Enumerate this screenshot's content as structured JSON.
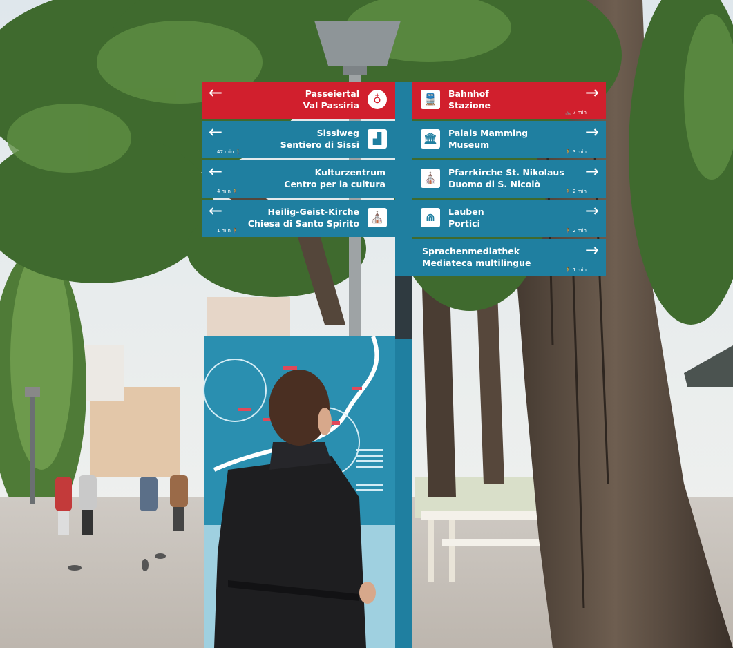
{
  "signs_left": [
    {
      "arrow": "←",
      "line1": "Passeiertal",
      "line2": "Val Passiria",
      "icon": "bicycle-icon",
      "glyph": "♁",
      "time": "",
      "color": "red"
    },
    {
      "arrow": "←",
      "line1": "Sissiweg",
      "line2": "Sentiero di Sissi",
      "icon": "monument-icon",
      "glyph": "▟",
      "time": "47 min 🚶",
      "color": "blue"
    },
    {
      "arrow": "←",
      "line1": "Kulturzentrum",
      "line2": "Centro per la cultura",
      "icon": "",
      "glyph": "",
      "time": "4 min 🚶",
      "color": "blue"
    },
    {
      "arrow": "←",
      "line1": "Heilig-Geist-Kirche",
      "line2": "Chiesa di Santo Spirito",
      "icon": "church-icon",
      "glyph": "⛪",
      "time": "1 min 🚶",
      "color": "blue"
    }
  ],
  "signs_right": [
    {
      "arrow": "→",
      "line1": "Bahnhof",
      "line2": "Stazione",
      "icon": "train-icon",
      "glyph": "🚆",
      "time": "🚲 7 min",
      "color": "red"
    },
    {
      "arrow": "→",
      "line1": "Palais Mamming",
      "line2": "Museum",
      "icon": "museum-icon",
      "glyph": "🏛",
      "time": "🚶 3 min",
      "color": "blue"
    },
    {
      "arrow": "→",
      "line1": "Pfarrkirche St. Nikolaus",
      "line2": "Duomo di S. Nicolò",
      "icon": "church-icon",
      "glyph": "⛪",
      "time": "🚶 2 min",
      "color": "blue"
    },
    {
      "arrow": "→",
      "line1": "Lauben",
      "line2": "Portici",
      "icon": "arcade-icon",
      "glyph": "⋒",
      "time": "🚶 2 min",
      "color": "blue"
    },
    {
      "arrow": "→",
      "line1": "Sprachenmediathek",
      "line2": "Mediateca multilingue",
      "icon": "",
      "glyph": "",
      "time": "🚶 1 min",
      "color": "blue"
    }
  ],
  "colors": {
    "sign_red": "#d11f2d",
    "sign_blue": "#1f7fa0",
    "map_blue": "#2a8fb0",
    "foliage": "#3f6a2e",
    "trunk": "#5a4a3c"
  }
}
